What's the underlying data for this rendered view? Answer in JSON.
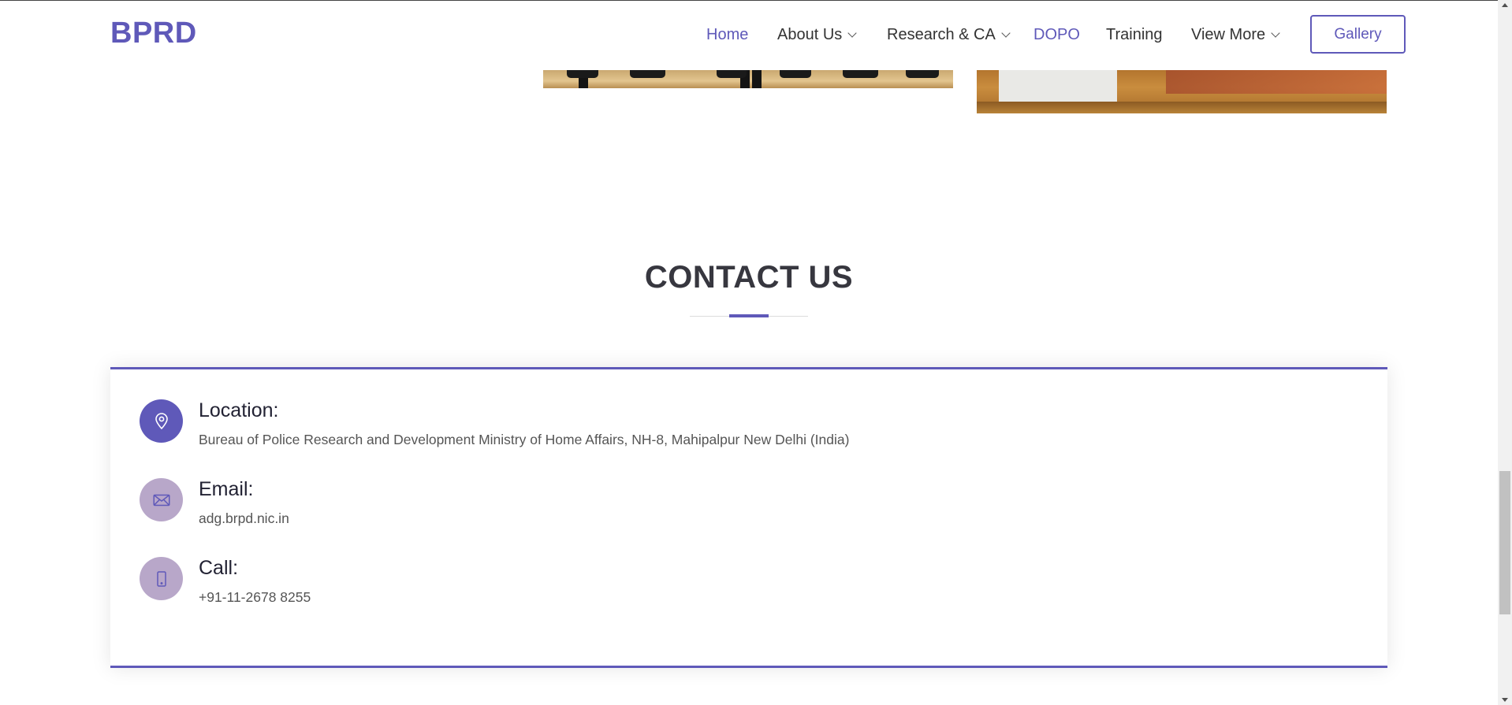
{
  "header": {
    "logo": "BPRD",
    "nav": [
      {
        "label": "Home",
        "active": true,
        "dropdown": false
      },
      {
        "label": "About Us",
        "active": false,
        "dropdown": true
      },
      {
        "label": "Research & CA",
        "active": false,
        "dropdown": true
      },
      {
        "label": "DOPO",
        "active": true,
        "dropdown": false
      },
      {
        "label": "Training",
        "active": false,
        "dropdown": false
      },
      {
        "label": "View More",
        "active": false,
        "dropdown": true
      }
    ],
    "gallery_button": "Gallery"
  },
  "section": {
    "title": "CONTACT US"
  },
  "contact": {
    "location": {
      "title": "Location:",
      "text": "Bureau of Police Research and Development Ministry of Home Affairs, NH-8, Mahipalpur New Delhi (India)",
      "icon": "map-pin-icon"
    },
    "email": {
      "title": "Email:",
      "text": "adg.brpd.nic.in",
      "icon": "envelope-icon"
    },
    "call": {
      "title": "Call:",
      "text": "+91-11-2678 8255",
      "icon": "mobile-phone-icon"
    }
  },
  "colors": {
    "accent": "#5f59b9",
    "icon_muted": "#b8a7c9",
    "heading": "#37373f"
  }
}
